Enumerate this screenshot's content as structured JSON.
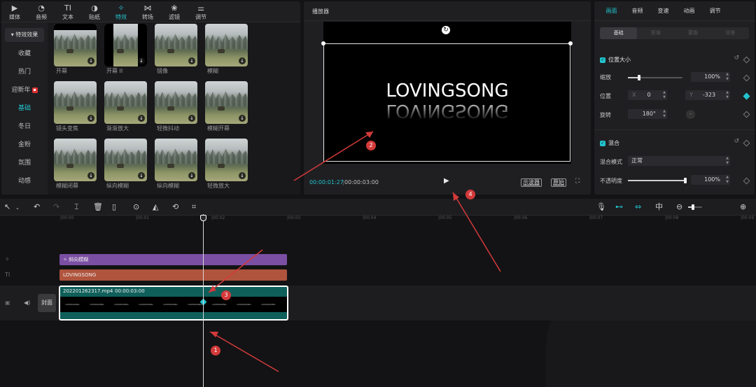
{
  "left_panel": {
    "tabs": [
      {
        "label": "媒体",
        "icon": "media-icon"
      },
      {
        "label": "音频",
        "icon": "audio-icon"
      },
      {
        "label": "文本",
        "icon": "text-icon"
      },
      {
        "label": "贴纸",
        "icon": "sticker-icon"
      },
      {
        "label": "特效",
        "icon": "effects-icon",
        "active": true
      },
      {
        "label": "转场",
        "icon": "transition-icon"
      },
      {
        "label": "滤镜",
        "icon": "filter-icon"
      },
      {
        "label": "调节",
        "icon": "adjust-icon"
      }
    ],
    "categories": [
      "▾ 特效效果",
      "收藏",
      "热门",
      "迎新年",
      "基础",
      "冬日",
      "金粉",
      "氛围",
      "动感"
    ],
    "active_category": "基础",
    "effects": [
      "开幕",
      "开幕 II",
      "镜像",
      "模糊",
      "镜头变焦",
      "渐渐放大",
      "轻微抖动",
      "模糊开幕",
      "模糊闭幕",
      "纵向模糊",
      "纵向模糊",
      "轻微放大"
    ]
  },
  "player": {
    "title": "播放器",
    "preview_text": "LOVINGSONG",
    "current_time": "00:00:01:27",
    "total_time": "00:00:03:00",
    "btn_scope": "示波器",
    "btn_original": "原始"
  },
  "inspector": {
    "tabs": [
      "画面",
      "音频",
      "变速",
      "动画",
      "调节"
    ],
    "subtabs": [
      "基础",
      "抠像",
      "蒙版",
      "背景"
    ],
    "position_size": {
      "title": "位置大小",
      "scale_label": "缩放",
      "scale_value": "100%",
      "scale_fraction": 0.2,
      "position_label": "位置",
      "x_prefix": "X",
      "x_value": "0",
      "y_prefix": "Y",
      "y_value": "-323",
      "rotation_label": "旋转",
      "rotation_value": "180°"
    },
    "blend": {
      "title": "混合",
      "mode_label": "混合模式",
      "mode_value": "正常",
      "opacity_label": "不透明度",
      "opacity_value": "100%",
      "opacity_fraction": 1.0
    }
  },
  "timeline": {
    "ruler": [
      "|00:00",
      "|00:01",
      "|00:02",
      "|00:03",
      "|00:04",
      "|00:05",
      "|00:06",
      "|00:07",
      "|00:08",
      "|00:09"
    ],
    "effect_clip": "斜向模糊",
    "text_clip": "LOVINGSONG",
    "video_name": "202201262317.mp4",
    "video_duration": "00:00:03:00",
    "cover_label": "封面",
    "thumb_text": "LOVINGSONG"
  },
  "annotations": [
    "1",
    "2",
    "3",
    "4"
  ],
  "colors": {
    "accent": "#22c4ce",
    "effect_clip": "#7b4fa3",
    "text_clip": "#b0543d",
    "video_clip": "#0f5f5a",
    "annotation": "#d33a3a"
  }
}
